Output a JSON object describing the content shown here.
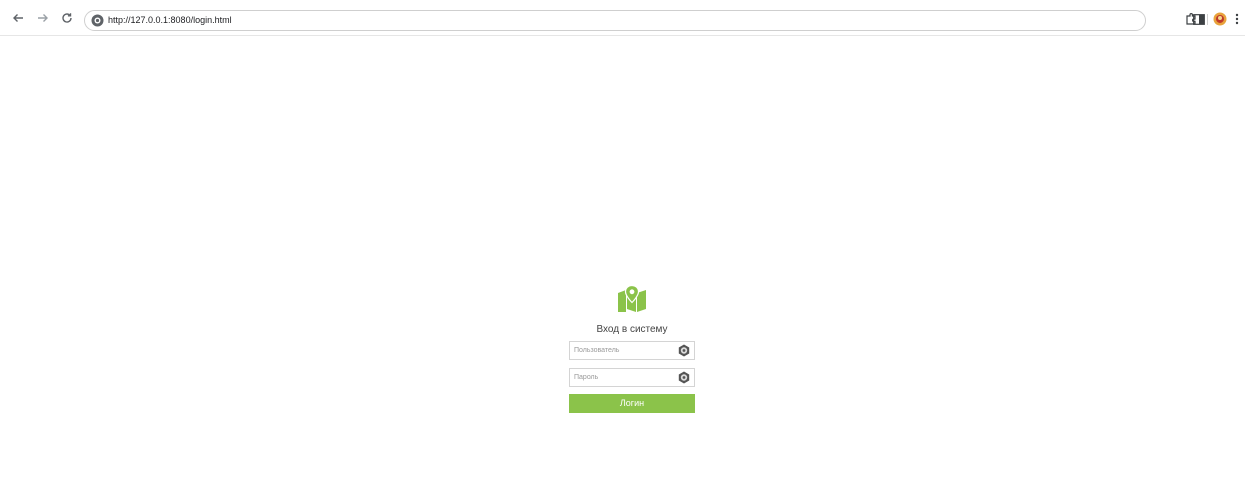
{
  "browser": {
    "url": "http://127.0.0.1:8080/login.html",
    "icons": [
      "back-icon",
      "forward-icon",
      "reload-icon",
      "site-info-icon",
      "extensions-icon",
      "side-panel-icon",
      "profile-icon",
      "menu-icon"
    ]
  },
  "login": {
    "title": "Вход в систему",
    "username_placeholder": "Пользователь",
    "password_placeholder": "Пароль",
    "submit_label": "Логин",
    "logo_icon": "map-pin-icon",
    "accent_color": "#8bc34a"
  }
}
